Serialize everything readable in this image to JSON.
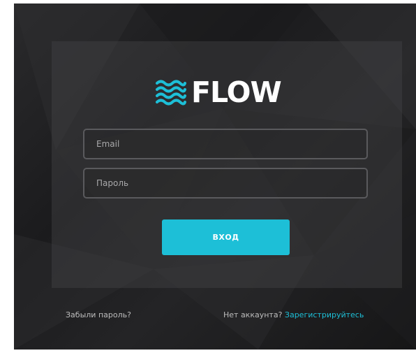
{
  "brand": {
    "name": "FLOW",
    "icon": "waves-icon",
    "accent_color": "#1dbfd7"
  },
  "form": {
    "email_placeholder": "Email",
    "password_placeholder": "Пароль",
    "submit_label": "ВХОД"
  },
  "footer": {
    "forgot_password": "Забыли пароль?",
    "no_account": "Нет аккаунта?",
    "register": "Зарегистрируйтесь"
  }
}
